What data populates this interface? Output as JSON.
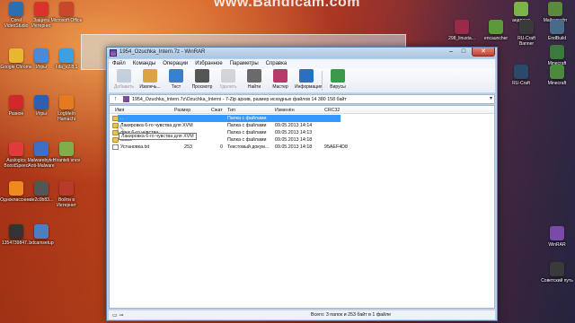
{
  "watermark": "www.Bandicam.com",
  "desktop_left": [
    {
      "label": "Corel VideoStudio",
      "color": "#2a6fb0"
    },
    {
      "label": "Защита Интернет",
      "color": "#d9332b"
    },
    {
      "label": "Microsoft Office",
      "color": "#c9482b"
    },
    {
      "label": "Google Chrome",
      "color": "#e8b630"
    },
    {
      "label": "Игры",
      "color": "#4a8ad8"
    },
    {
      "label": "Fifa_v2.8.1",
      "color": "#3da0e0"
    },
    {
      "label": "Разное",
      "color": "#d2282a"
    },
    {
      "label": "Игры",
      "color": "#2e5fb0"
    },
    {
      "label": "LogMeIn Hamachi",
      "color": "#e67a1f"
    },
    {
      "label": "Auslogics BoostSpeed",
      "color": "#e03a3a"
    },
    {
      "label": "Malwarebytes Anti-Malware",
      "color": "#3d6fc4"
    },
    {
      "label": "Hiranteli snov",
      "color": "#7fae4a"
    },
    {
      "label": "Одноклассники",
      "color": "#f08a1a"
    },
    {
      "label": "de2c0b83...",
      "color": "#555555"
    },
    {
      "label": "Войти в Интернет",
      "color": "#b83a2a"
    },
    {
      "label": "1354739847...",
      "color": "#333333"
    },
    {
      "label": "bdcamsetup",
      "color": "#4a7fc0"
    }
  ],
  "desktop_right": [
    {
      "label": "андроид",
      "color": "#7ab34a"
    },
    {
      "label": "Майнкрафт",
      "color": "#5a8a3a"
    },
    {
      "label": "298_linuxta...",
      "color": "#9a2a4a"
    },
    {
      "label": "encauncher",
      "color": "#5a9a3a"
    },
    {
      "label": "RU-Craft Banner",
      "color": "#3a3a3a"
    },
    {
      "label": "EndBuild",
      "color": "#4a6a8a"
    },
    {
      "label": "Minecraft",
      "color": "#3a7a3a"
    },
    {
      "label": "RU-Craft",
      "color": "#2a4a6a"
    },
    {
      "label": "Minecraft",
      "color": "#4a8a3a"
    },
    {
      "label": "WinRAR",
      "color": "#7a4aa8"
    },
    {
      "label": "Советский путь",
      "color": "#3a3a3a"
    }
  ],
  "window": {
    "title": "1954_Ozuchka_Intern.7z - WinRAR",
    "btn_min": "–",
    "btn_max": "□",
    "btn_close": "✕"
  },
  "menu": [
    "Файл",
    "Команды",
    "Операции",
    "Избранное",
    "Параметры",
    "Справка"
  ],
  "toolbar": [
    {
      "label": "Добавить",
      "color": "#8aa0b8",
      "disabled": true
    },
    {
      "label": "Извлечь...",
      "color": "#d9a441",
      "disabled": false
    },
    {
      "label": "Тест",
      "color": "#3a80d0",
      "disabled": false
    },
    {
      "label": "Просмотр",
      "color": "#555555",
      "disabled": false
    },
    {
      "label": "Удалить",
      "color": "#a8a8a8",
      "disabled": true
    },
    {
      "label": "Найти",
      "color": "#6a6a6a",
      "disabled": false
    },
    {
      "label": "Мастер",
      "color": "#b83a6a",
      "disabled": false
    },
    {
      "label": "Информация",
      "color": "#2a6fc0",
      "disabled": false
    },
    {
      "label": "Вирусы",
      "color": "#3a9a4a",
      "disabled": false
    }
  ],
  "pathbar": {
    "path": "1954_Ozuchka_Intern.7z\\Ozuchka_Interni - 7-Zip архив, размер исходных файлов 14 380 158 байт",
    "up": "↑",
    "dropdown": "▾"
  },
  "columns": [
    "Имя",
    "Размер",
    "Сжат",
    "Тип",
    "Изменён",
    "CRC32"
  ],
  "rows": [
    {
      "name": "..",
      "size": "",
      "packed": "",
      "type": "Папка с файлами",
      "modified": "",
      "crc": "",
      "icon": "upfolder",
      "selected": true
    },
    {
      "name": "Лакировка 6-го чувства для XVM",
      "size": "",
      "packed": "",
      "type": "Папка с файлами",
      "modified": "09.05.2013 14:14",
      "crc": "",
      "icon": "folder",
      "selected": false
    },
    {
      "name": "Звук 6-го чувства",
      "size": "",
      "packed": "",
      "type": "Папка с файлами",
      "modified": "09.05.2013 14:13",
      "crc": "",
      "icon": "folder",
      "selected": false
    },
    {
      "name": "audio",
      "size": "",
      "packed": "",
      "type": "Папка с файлами",
      "modified": "09.05.2013 14:18",
      "crc": "",
      "icon": "folder",
      "selected": false
    },
    {
      "name": "Установка.txt",
      "size": "253",
      "packed": "0",
      "type": "Текстовый докум...",
      "modified": "09.05.2013 14:18",
      "crc": "95AEF4D8",
      "icon": "txtfile",
      "selected": false
    }
  ],
  "tooltip": "Лакировка 6-го чувства для XVM",
  "status": {
    "icons": "▭ ⊸",
    "text": "Всего: 3 папок и 253 байт в 1 файле"
  }
}
